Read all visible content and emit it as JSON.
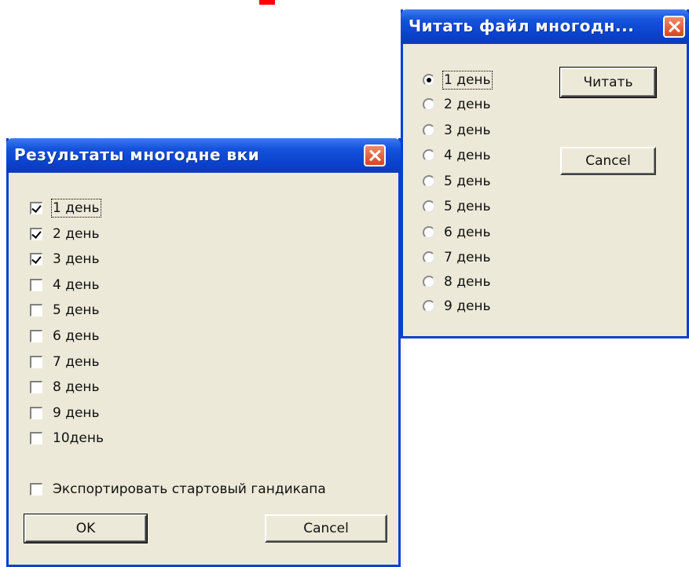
{
  "results_dialog": {
    "title": "Результаты многодне вки",
    "days": [
      {
        "label": "1 день",
        "checked": true
      },
      {
        "label": "2 день",
        "checked": true
      },
      {
        "label": "3 день",
        "checked": true
      },
      {
        "label": "4 день",
        "checked": false
      },
      {
        "label": "5 день",
        "checked": false
      },
      {
        "label": "6 день",
        "checked": false
      },
      {
        "label": "7 день",
        "checked": false
      },
      {
        "label": "8 день",
        "checked": false
      },
      {
        "label": "9 день",
        "checked": false
      },
      {
        "label": "10день",
        "checked": false
      }
    ],
    "export_label": "Экспортировать стартовый гандикапа",
    "export_checked": false,
    "ok_label": "OK",
    "cancel_label": "Cancel"
  },
  "read_dialog": {
    "title": "Читать файл многодн...",
    "days": [
      "1 день",
      "2 день",
      "3 день",
      "4 день",
      "5 день",
      "5 день",
      "6 день",
      "7 день",
      "8 день",
      "9 день"
    ],
    "selected_index": 0,
    "read_label": "Читать",
    "cancel_label": "Cancel"
  },
  "colors": {
    "title_bar": "#0b43cf",
    "dialog_bg": "#ece9d8",
    "close_button": "#d6451f"
  }
}
